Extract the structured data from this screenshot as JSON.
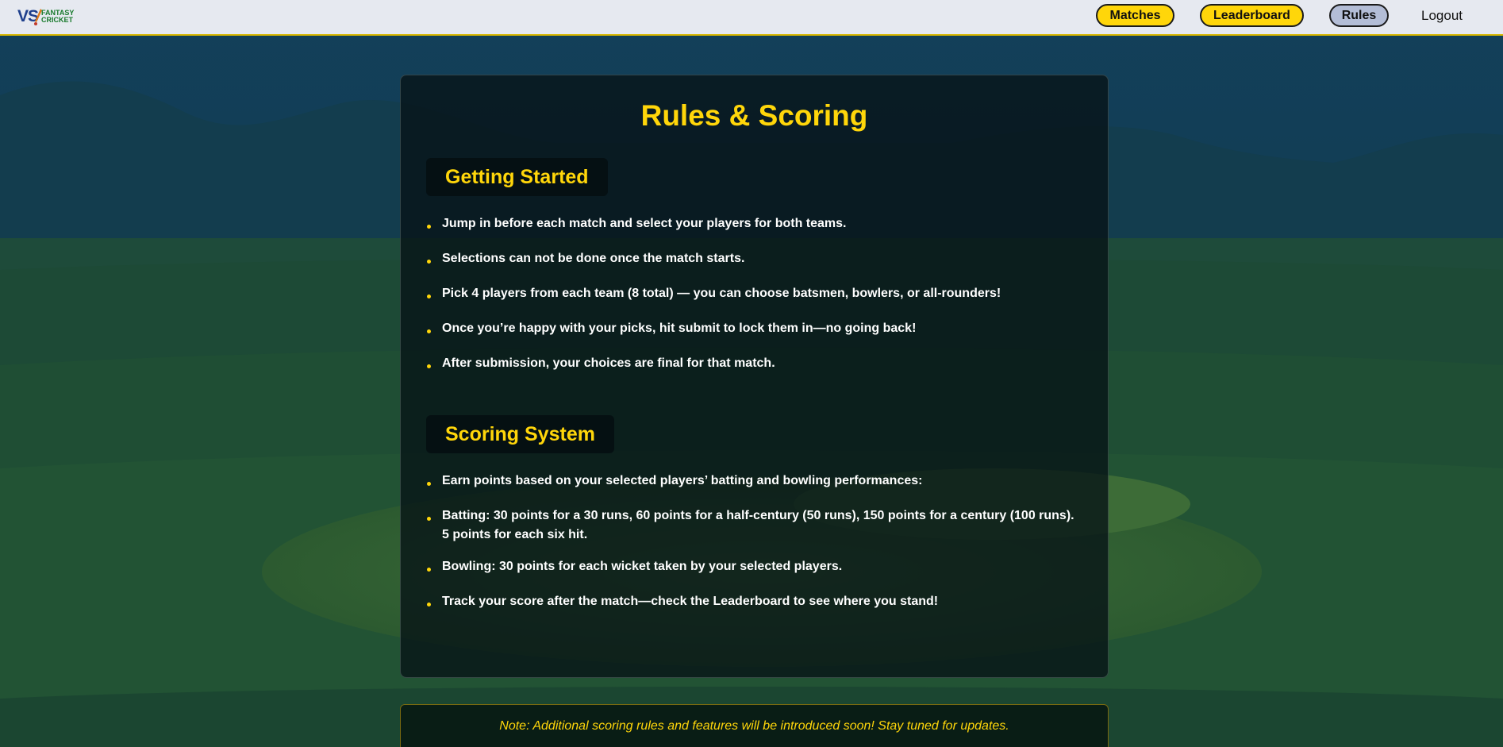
{
  "nav": {
    "logo_vs": "VS",
    "logo_line1": "FANTASY",
    "logo_line2": "CRICKET",
    "matches": "Matches",
    "leaderboard": "Leaderboard",
    "rules": "Rules",
    "logout": "Logout"
  },
  "page": {
    "title": "Rules & Scoring"
  },
  "getting_started": {
    "heading": "Getting Started",
    "items": [
      "Jump in before each match and select your players for both teams.",
      "Selections can not be done once the match starts.",
      "Pick 4 players from each team (8 total) — you can choose batsmen, bowlers, or all-rounders!",
      "Once you’re happy with your picks, hit submit to lock them in—no going back!",
      "After submission, your choices are final for that match."
    ]
  },
  "scoring": {
    "heading": "Scoring System",
    "items": [
      "Earn points based on your selected players’ batting and bowling performances:",
      "Batting: 30 points for a 30 runs, 60 points for a half-century (50 runs), 150 points for a century (100 runs). 5 points for each six hit.",
      "Bowling: 30 points for each wicket taken by your selected players.",
      "Track your score after the match—check the Leaderboard to see where you stand!"
    ]
  },
  "note": {
    "text": "Note: Additional scoring rules and features will be introduced soon! Stay tuned for updates."
  },
  "colors": {
    "accent": "#ffd60a",
    "nav_bg": "#e6e9f0",
    "rules_button": "#b3bdd6",
    "card_bg": "#061216"
  }
}
